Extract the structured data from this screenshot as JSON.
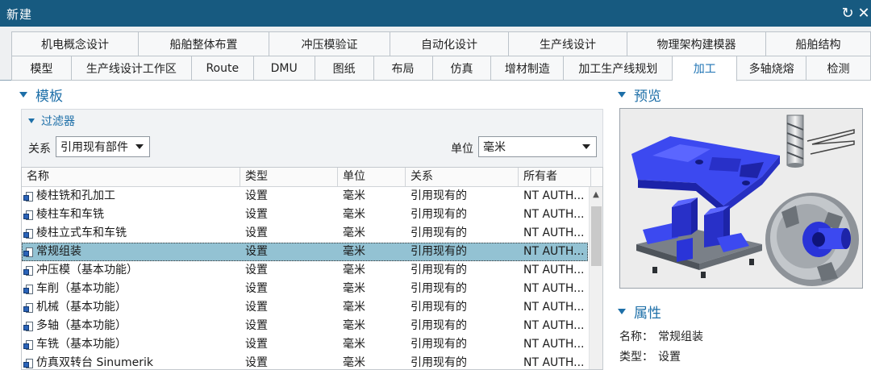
{
  "window": {
    "title": "新建",
    "restore_symbol": "↻",
    "close_symbol": "✕"
  },
  "tabs_row1": [
    {
      "label": "机电概念设计",
      "w": 158
    },
    {
      "label": "船舶整体布置",
      "w": 162
    },
    {
      "label": "冲压模验证",
      "w": 150
    },
    {
      "label": "自动化设计",
      "w": 147
    },
    {
      "label": "生产线设计",
      "w": 147
    },
    {
      "label": "物理架构建模器",
      "w": 172
    },
    {
      "label": "船舶结构",
      "w": 130
    }
  ],
  "tabs_row2": [
    {
      "label": "模型",
      "w": 75
    },
    {
      "label": "生产线设计工作区",
      "w": 149
    },
    {
      "label": "Route",
      "w": 77
    },
    {
      "label": "DMU",
      "w": 76
    },
    {
      "label": "图纸",
      "w": 73
    },
    {
      "label": "布局",
      "w": 73
    },
    {
      "label": "仿真",
      "w": 73
    },
    {
      "label": "增材制造",
      "w": 90
    },
    {
      "label": "加工生产线规划",
      "w": 135
    },
    {
      "label": "加工",
      "w": 80,
      "active": true
    },
    {
      "label": "多轴烧熔",
      "w": 86
    },
    {
      "label": "检测",
      "w": 80
    }
  ],
  "template_section": {
    "title": "模板",
    "filter": {
      "title": "过滤器",
      "relation_label": "关系",
      "relation_value": "引用现有部件",
      "unit_label": "单位",
      "unit_value": "毫米"
    },
    "columns": [
      "名称",
      "类型",
      "单位",
      "关系",
      "所有者"
    ],
    "rows": [
      {
        "name": "棱柱铣和孔加工",
        "type": "设置",
        "unit": "毫米",
        "relation": "引用现有的",
        "owner": "NT AUTH..."
      },
      {
        "name": "棱柱车和车铣",
        "type": "设置",
        "unit": "毫米",
        "relation": "引用现有的",
        "owner": "NT AUTH..."
      },
      {
        "name": "棱柱立式车和车铣",
        "type": "设置",
        "unit": "毫米",
        "relation": "引用现有的",
        "owner": "NT AUTH..."
      },
      {
        "name": "常规组装",
        "type": "设置",
        "unit": "毫米",
        "relation": "引用现有的",
        "owner": "NT AUTH...",
        "selected": true
      },
      {
        "name": "冲压模（基本功能）",
        "type": "设置",
        "unit": "毫米",
        "relation": "引用现有的",
        "owner": "NT AUTH..."
      },
      {
        "name": "车削（基本功能）",
        "type": "设置",
        "unit": "毫米",
        "relation": "引用现有的",
        "owner": "NT AUTH..."
      },
      {
        "name": "机械（基本功能）",
        "type": "设置",
        "unit": "毫米",
        "relation": "引用现有的",
        "owner": "NT AUTH..."
      },
      {
        "name": "多轴（基本功能）",
        "type": "设置",
        "unit": "毫米",
        "relation": "引用现有的",
        "owner": "NT AUTH..."
      },
      {
        "name": "车铣（基本功能）",
        "type": "设置",
        "unit": "毫米",
        "relation": "引用现有的",
        "owner": "NT AUTH..."
      },
      {
        "name": "仿真双转台 Sinumerik",
        "type": "设置",
        "unit": "毫米",
        "relation": "引用现有的",
        "owner": "NT AUTH..."
      }
    ]
  },
  "preview_section": {
    "title": "预览"
  },
  "properties_section": {
    "title": "属性",
    "name_label": "名称：",
    "name_value": "常规组装",
    "type_label": "类型：",
    "type_value": "设置"
  },
  "colors": {
    "titlebar": "#175a80",
    "accent": "#1d6fa8",
    "selected_row": "#93c2d3",
    "part_blue": "#2f3fe0"
  }
}
